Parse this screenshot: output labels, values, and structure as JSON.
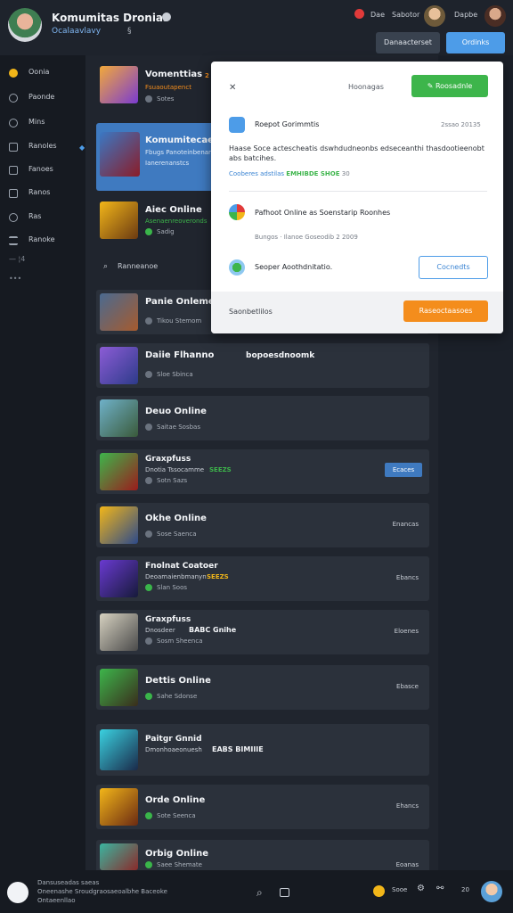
{
  "header": {
    "title": "Komumitas Dronias",
    "subtitle": "Ocalaavlavy",
    "sub_icon": "§",
    "links": [
      "Dae",
      "Sabotor",
      "Dapbe"
    ],
    "btn_secondary": "Danaacterset",
    "btn_primary": "Ordinks"
  },
  "sidebar": {
    "items": [
      {
        "label": "Oonia",
        "icon": "home-icon"
      },
      {
        "label": "Paonde",
        "icon": "people-icon"
      },
      {
        "label": "Mins",
        "icon": "clock-icon"
      },
      {
        "label": "Ranoles",
        "icon": "list-icon"
      },
      {
        "label": "Fanoes",
        "icon": "bookmark-icon"
      },
      {
        "label": "Ranos",
        "icon": "chat-icon"
      },
      {
        "label": "Ras",
        "icon": "user-icon"
      },
      {
        "label": "Ranoke",
        "icon": "grid-icon"
      },
      {
        "label": "— ¦4",
        "icon": "divider-icon"
      },
      {
        "label": "•••",
        "icon": "more-icon"
      }
    ]
  },
  "games": [
    {
      "name": "Vomenttias",
      "tag": "2",
      "tag_sub": "Fsuaoutapenct",
      "meta": "Sotes"
    },
    {
      "name": "Komumitecae",
      "tag": "",
      "tag_sub": "Fbugs Panoteinbenan",
      "meta": "Ianerenanstcs"
    },
    {
      "name": "Aiec Online",
      "tag": "",
      "tag_sub": "Asenaenreoveronds",
      "meta": "Sadig"
    },
    {
      "name": "Panie Onlemecl",
      "tag": "",
      "tag_sub": "",
      "meta": "Tikou Stemom"
    },
    {
      "name": "Daiie Flhanno",
      "tag": "bopoesdnoomk",
      "tag_sub": "",
      "meta": "Sloe Sbinca"
    },
    {
      "name": "Deuo Online",
      "tag": "",
      "tag_sub": "",
      "meta": "Saitae Sosbas"
    },
    {
      "name": "Graxpfuss",
      "tag": "SEEZS",
      "tag_sub": "Dnotia Tssocamme",
      "meta": "Sotn Sazs",
      "btn": "Ecaces"
    },
    {
      "name": "Okhe Online",
      "tag": "",
      "tag_sub": "",
      "meta": "Sose Saenca",
      "right": "Enancas"
    },
    {
      "name": "Fnolnat Coatoer",
      "tag": "SEEZS",
      "tag_sub": "Deoamaienbmanyn",
      "meta": "Slan Soos",
      "right": "Ebancs"
    },
    {
      "name": "Graxpfuss",
      "tag": "BABC Gnihe",
      "tag_sub": "Dnosdeer",
      "meta": "Sosm Sheenca",
      "right": "Eloenes"
    },
    {
      "name": "Dettis Online",
      "tag": "",
      "tag_sub": "",
      "meta": "Sahe Sdonse",
      "right": "Ebasce"
    },
    {
      "name": "Paitgr Gnnid",
      "tag": "EABS BIMIIIE",
      "tag_sub": "Dmonhoaeonuesh",
      "meta": "",
      "right": ""
    },
    {
      "name": "Orde Online",
      "tag": "",
      "tag_sub": "",
      "meta": "Sote Seenca",
      "right": "Ehancs"
    },
    {
      "name": "Orbig Online",
      "tag": "",
      "tag_sub": "",
      "meta": "Saee Shemate",
      "right": "Eoanas"
    }
  ],
  "section": {
    "label": "Ranneanoe"
  },
  "modal": {
    "header_label": "Hoonagas",
    "header_btn": "Roosadnle",
    "row1_title": "Roepot Gorimmtis",
    "row1_date": "2ssao 20135",
    "body": "Haase Soce actescheatis dswhdudneonbs edseceanthi thasdootieenobt abs batcihes.",
    "link_blue": "Cooberes adstilas",
    "link_green": "EMHIBDE SHOE",
    "link_num": "30",
    "row2_title": "Pafhoot Online as Soenstarip Roonhes",
    "row2_meta": "Bungos · Ilanoe Goseodib 2 2009",
    "row3_title": "Seoper Aoothdnitatio.",
    "row3_btn": "Cocnedts",
    "footer_label": "Saonbetlilos",
    "footer_btn": "Raseoctaasoes",
    "colors": {
      "green": "#3db54b",
      "orange": "#f48d1c",
      "blue": "#4d9ce8"
    }
  },
  "bottom": {
    "line1": "Dansuseadas saeas",
    "line2": "Oneenashe Sroudgraosaeoalbhe Baceoke",
    "line3": "Ontaeenllao",
    "right1": "Sooe",
    "right2": "20"
  }
}
